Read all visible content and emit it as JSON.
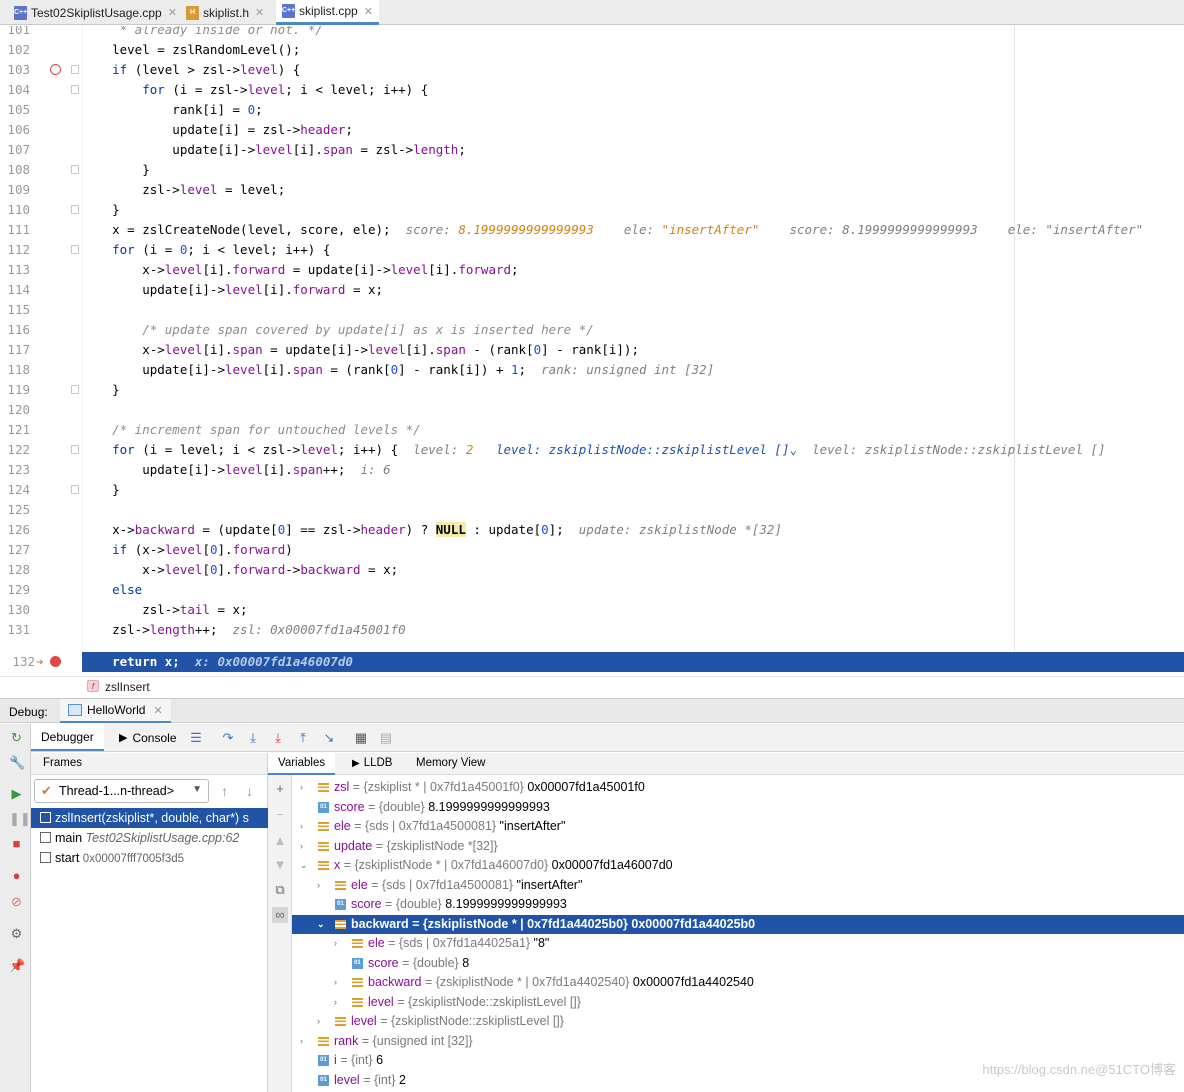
{
  "tabs": [
    {
      "icon": "C++",
      "label": "Test02SkiplistUsage.cpp"
    },
    {
      "icon": "H",
      "label": "skiplist.h"
    },
    {
      "icon": "C++",
      "label": "skiplist.cpp"
    }
  ],
  "editor": {
    "lines": [
      {
        "n": "101",
        "code": "     * already inside or not. */"
      },
      {
        "n": "102",
        "code": "    level = zslRandomLevel();"
      },
      {
        "n": "103",
        "code": "    if (level > zsl->level) {"
      },
      {
        "n": "104",
        "code": "        for (i = zsl->level; i < level; i++) {"
      },
      {
        "n": "105",
        "code": "            rank[i] = 0;"
      },
      {
        "n": "106",
        "code": "            update[i] = zsl->header;"
      },
      {
        "n": "107",
        "code": "            update[i]->level[i].span = zsl->length;"
      },
      {
        "n": "108",
        "code": "        }"
      },
      {
        "n": "109",
        "code": "        zsl->level = level;"
      },
      {
        "n": "110",
        "code": "    }"
      },
      {
        "n": "111",
        "code": "    x = zslCreateNode(level, score, ele);"
      },
      {
        "n": "112",
        "code": "    for (i = 0; i < level; i++) {"
      },
      {
        "n": "113",
        "code": "        x->level[i].forward = update[i]->level[i].forward;"
      },
      {
        "n": "114",
        "code": "        update[i]->level[i].forward = x;"
      },
      {
        "n": "115",
        "code": ""
      },
      {
        "n": "116",
        "code": "        /* update span covered by update[i] as x is inserted here */"
      },
      {
        "n": "117",
        "code": "        x->level[i].span = update[i]->level[i].span - (rank[0] - rank[i]);"
      },
      {
        "n": "118",
        "code": "        update[i]->level[i].span = (rank[0] - rank[i]) + 1;"
      },
      {
        "n": "119",
        "code": "    }"
      },
      {
        "n": "120",
        "code": ""
      },
      {
        "n": "121",
        "code": "    /* increment span for untouched levels */"
      },
      {
        "n": "122",
        "code": "    for (i = level; i < zsl->level; i++) {"
      },
      {
        "n": "123",
        "code": "        update[i]->level[i].span++;"
      },
      {
        "n": "124",
        "code": "    }"
      },
      {
        "n": "125",
        "code": ""
      },
      {
        "n": "126",
        "code": "    x->backward = (update[0] == zsl->header) ? NULL : update[0];"
      },
      {
        "n": "127",
        "code": "    if (x->level[0].forward)"
      },
      {
        "n": "128",
        "code": "        x->level[0].forward->backward = x;"
      },
      {
        "n": "129",
        "code": "    else"
      },
      {
        "n": "130",
        "code": "        zsl->tail = x;"
      },
      {
        "n": "131",
        "code": "    zsl->length++;"
      },
      {
        "n": "132",
        "code": "    return x;"
      }
    ],
    "hints": {
      "l111_a": "score: ",
      "l111_b": "8.1999999999999993",
      "l111_c": "ele: ",
      "l111_d": "\"insertAfter\"",
      "l111_e": "score: 8.1999999999999993",
      "l111_f": "ele: \"insertAfter\"",
      "l118": "rank: unsigned int [32]",
      "l122_a": "level: ",
      "l122_b": "2",
      "l122_c": "level: zskiplistNode::zskiplistLevel []",
      "l122_d": "level: zskiplistNode::zskiplistLevel []",
      "l123": "i: 6",
      "l126": "update: zskiplistNode *[32]",
      "l131": "zsl: 0x00007fd1a45001f0",
      "l132": "x: 0x00007fd1a46007d0"
    }
  },
  "breadcrumb": {
    "icon": "f",
    "label": "zslInsert"
  },
  "debug": {
    "label": "Debug:",
    "run_tab": "HelloWorld",
    "tabs": {
      "debugger": "Debugger",
      "console": "Console"
    },
    "frames_header": "Frames",
    "thread": "Thread-1...n-thread>",
    "frames": [
      {
        "name": "zslInsert(zskiplist*, double, char*) s",
        "loc": "",
        "addr": ""
      },
      {
        "name": "main ",
        "loc": "Test02SkiplistUsage.cpp:62",
        "addr": ""
      },
      {
        "name": "start ",
        "loc": "",
        "addr": "0x00007fff7005f3d5"
      }
    ],
    "var_tabs": {
      "variables": "Variables",
      "lldb": "LLDB",
      "memory": "Memory View"
    },
    "variables": [
      {
        "name": "zsl",
        "type": " = {zskiplist * | 0x7fd1a45001f0} ",
        "value": "0x00007fd1a45001f0"
      },
      {
        "name": "score",
        "type": " = {double} ",
        "value": "8.1999999999999993"
      },
      {
        "name": "ele",
        "type": " = {sds | 0x7fd1a4500081} ",
        "value": "\"insertAfter\""
      },
      {
        "name": "update",
        "type": " = {zskiplistNode *[32]}",
        "value": ""
      },
      {
        "name": "x",
        "type": " = {zskiplistNode * | 0x7fd1a46007d0} ",
        "value": "0x00007fd1a46007d0"
      },
      {
        "name": "ele",
        "type": " = {sds | 0x7fd1a4500081} ",
        "value": "\"insertAfter\""
      },
      {
        "name": "score",
        "type": " = {double} ",
        "value": "8.1999999999999993"
      },
      {
        "name": "backward",
        "type": " = {zskiplistNode * | 0x7fd1a44025b0} ",
        "value": "0x00007fd1a44025b0"
      },
      {
        "name": "ele",
        "type": " = {sds | 0x7fd1a44025a1} ",
        "value": "\"8\""
      },
      {
        "name": "score",
        "type": " = {double} ",
        "value": "8"
      },
      {
        "name": "backward",
        "type": " = {zskiplistNode * | 0x7fd1a4402540} ",
        "value": "0x00007fd1a4402540"
      },
      {
        "name": "level",
        "type": " = {zskiplistNode::zskiplistLevel []}",
        "value": ""
      },
      {
        "name": "level",
        "type": " = {zskiplistNode::zskiplistLevel []}",
        "value": ""
      },
      {
        "name": "rank",
        "type": " = {unsigned int [32]}",
        "value": ""
      },
      {
        "name": "i",
        "type": " = {int} ",
        "value": "6"
      },
      {
        "name": "level",
        "type": " = {int} ",
        "value": "2"
      }
    ]
  },
  "watermark": "https://blog.csdn.ne@51CTO博客",
  "colors": {
    "selection": "#2154a6",
    "accent": "#4a88c7",
    "keyword": "#0033b3",
    "field": "#871094"
  }
}
